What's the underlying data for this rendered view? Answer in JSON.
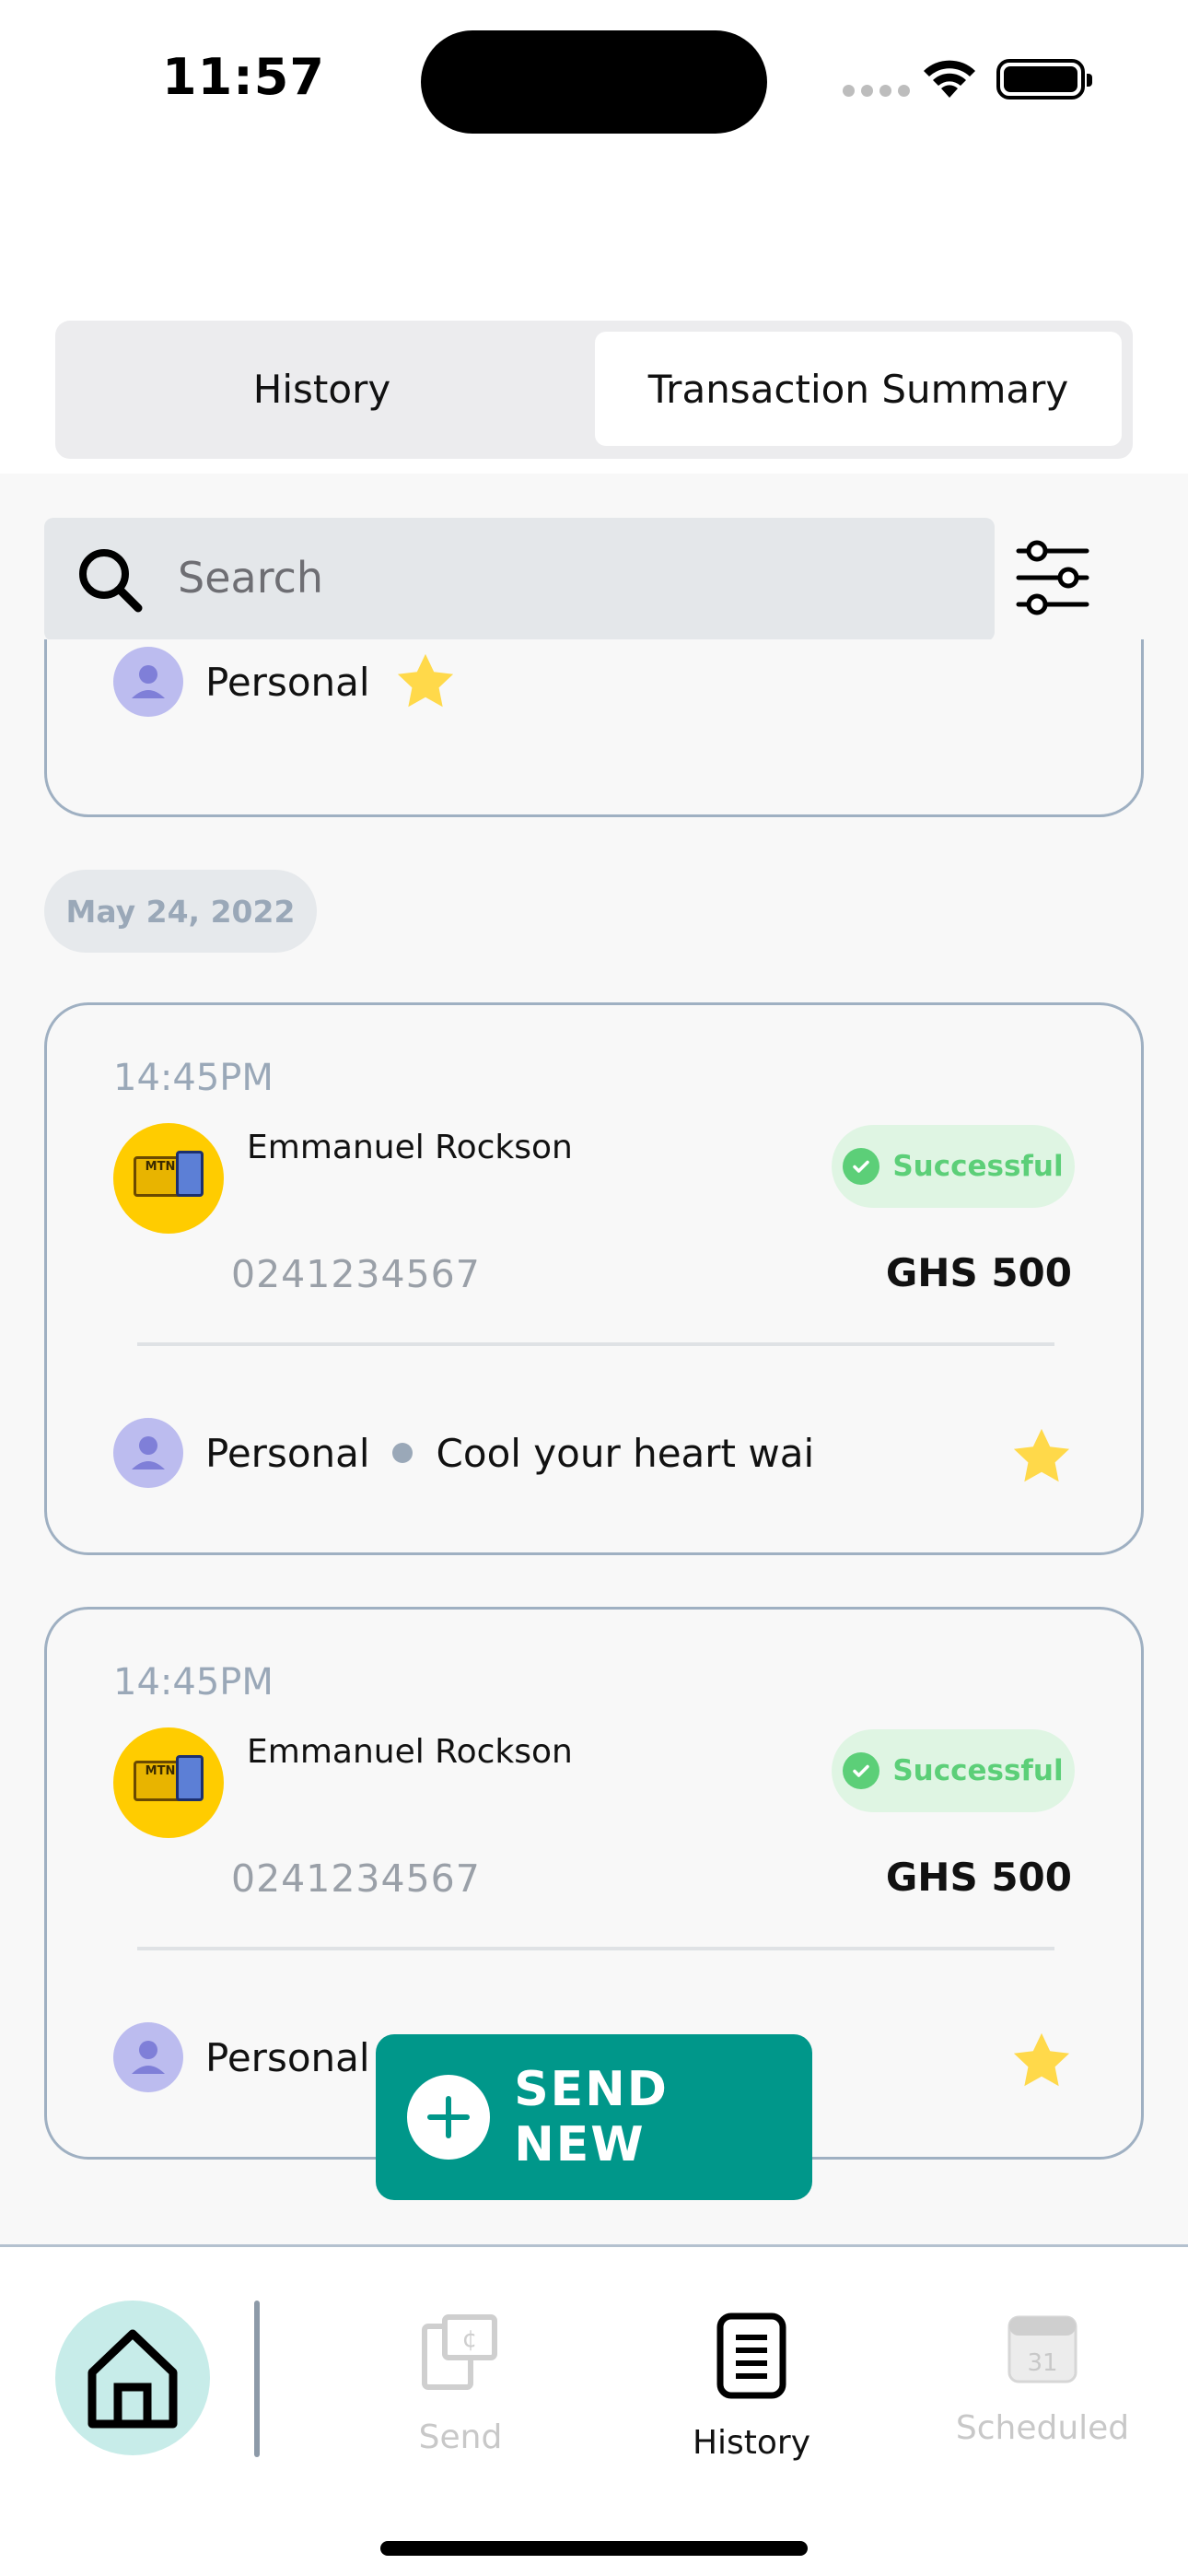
{
  "status_bar": {
    "time": "11:57"
  },
  "tabs": [
    {
      "label": "History",
      "selected": false
    },
    {
      "label": "Transaction Summary",
      "selected": true
    }
  ],
  "search": {
    "placeholder": "Search"
  },
  "partial_card": {
    "category": "Personal",
    "favorited": true
  },
  "date_group": "May 24, 2022",
  "transactions": [
    {
      "time": "14:45PM",
      "name": "Emmanuel Rockson",
      "status": "Successful",
      "phone": "0241234567",
      "amount": "GHS 500",
      "category": "Personal",
      "note": "Cool your heart wai",
      "favorited": true
    },
    {
      "time": "14:45PM",
      "name": "Emmanuel Rockson",
      "status": "Successful",
      "phone": "0241234567",
      "amount": "GHS 500",
      "category": "Personal",
      "favorited": true
    }
  ],
  "fab": {
    "label": "SEND NEW"
  },
  "bottom_nav": {
    "items": [
      {
        "label": "Send",
        "icon": "send-money-icon",
        "active": false
      },
      {
        "label": "History",
        "icon": "history-icon",
        "active": true
      },
      {
        "label": "Scheduled",
        "icon": "calendar-icon",
        "active": false
      }
    ],
    "home_icon": "home-icon"
  },
  "colors": {
    "accent": "#00978A",
    "success": "#5CCF78",
    "success_bg": "#DFF5E3",
    "muted": "#9AA8B8",
    "star": "#FFD94A",
    "home_bg": "#C7ECE9"
  }
}
